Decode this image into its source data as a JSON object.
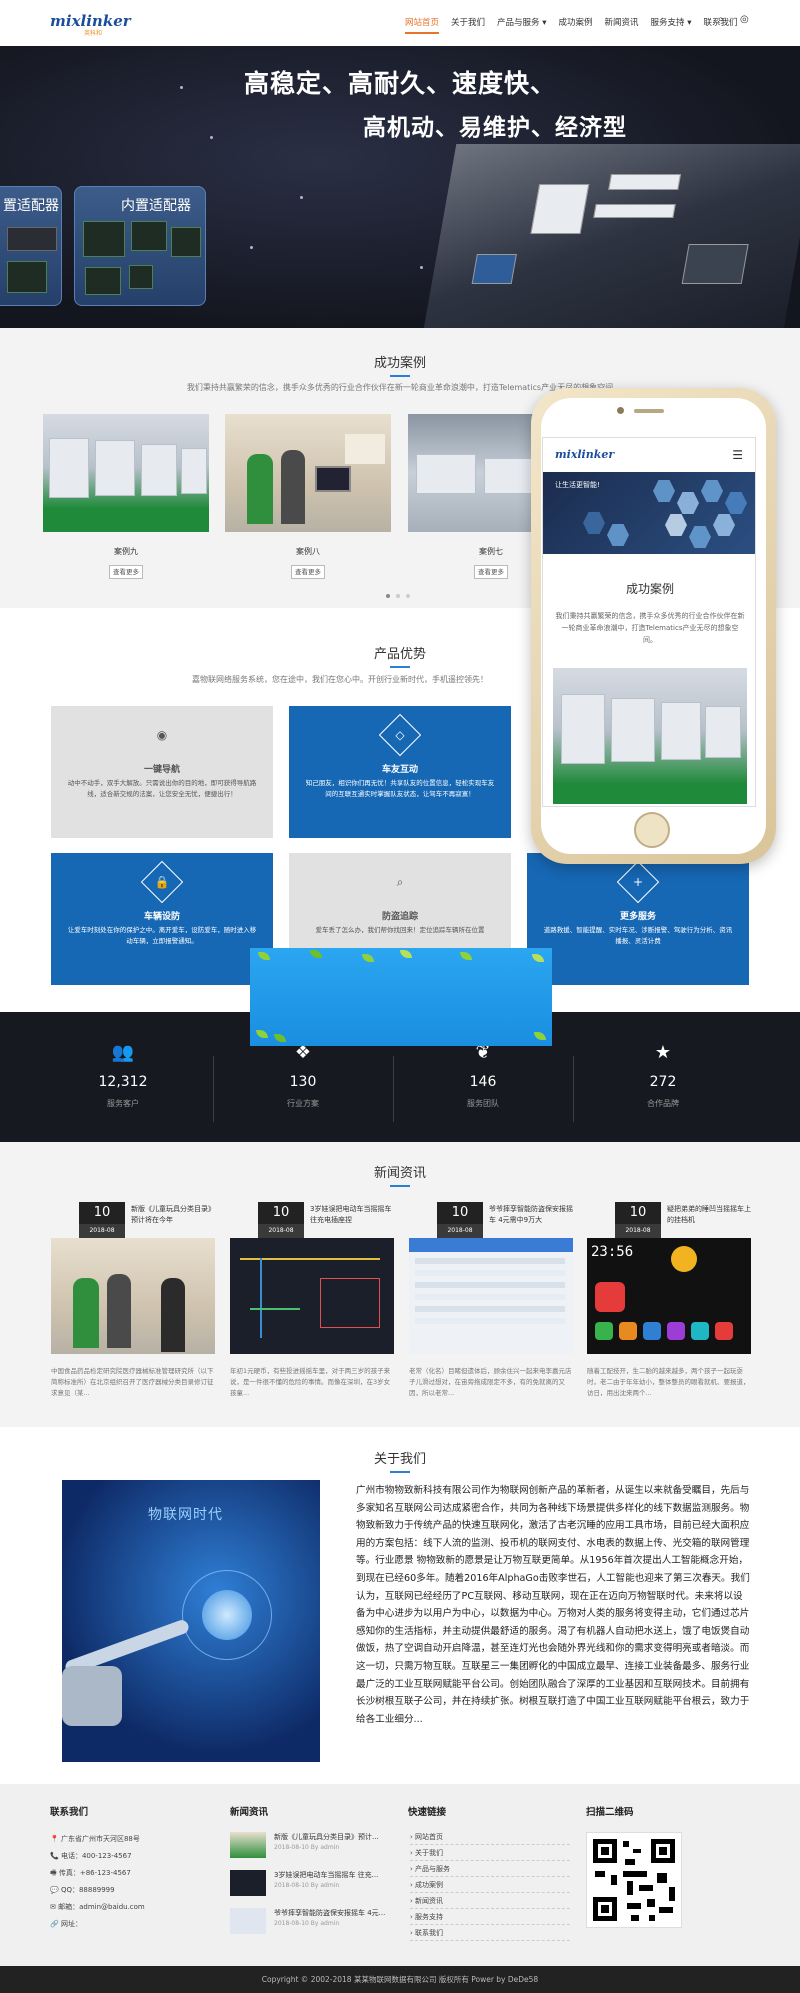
{
  "header": {
    "logo_text": "mixlinker",
    "logo_sub": "英科和",
    "nav": [
      "网站首页",
      "关于我们",
      "产品与服务 ▾",
      "成功案例",
      "新闻资讯",
      "服务支持 ▾",
      "联系我们"
    ],
    "active_index": 0
  },
  "banner": {
    "headline_1": "高稳定、高耐久、速度快、",
    "headline_2": "高机动、易维护、经济型",
    "card_left": "置适配器",
    "card_right": "内置适配器"
  },
  "cases": {
    "title": "成功案例",
    "subtitle": "我们秉持共赢繁荣的信念，携手众多优秀的行业合作伙伴在新一轮商业革命浪潮中，打造Telematics产业无尽的想象空间",
    "items": [
      {
        "name": "案例九",
        "button": "查看更多"
      },
      {
        "name": "案例八",
        "button": "查看更多"
      },
      {
        "name": "案例七",
        "button": "查看更多"
      }
    ]
  },
  "phone": {
    "logo": "mixlinker",
    "banner_text": "让生活更智能!",
    "title": "成功案例",
    "text": "我们秉持共赢繁荣的信念，携手众多优秀的行业合作伙伴在新一轮商业革命浪潮中，打造Telematics产业无尽的想象空间。"
  },
  "advantages": {
    "title": "产品优势",
    "subtitle": "嘉物联网络服务系统，您在途中，我们在您心中。开创行业新时代，手机遥控领先！",
    "items": [
      {
        "name": "一键导航",
        "desc": "动中不动手，双手大解放。只需说出你的目的地，即可获得导航路线，适合新交规的法案，让您安全无忧，便捷出行！",
        "icon": "globe-icon",
        "glyph": "◉",
        "style": "gray"
      },
      {
        "name": "车友互动",
        "desc": "知己朋友，相识你们再无忧！共享队友的位置信息，轻松实现车友间的互联互通实时掌握队友状态，让驾车不再寂寞！",
        "icon": "diamond-icon",
        "glyph": "◇",
        "style": "blue"
      },
      {
        "name": "车辆设防",
        "desc": "让爱车时刻处在你的保护之中。离开爱车，设防爱车，随时进入移动车辆，立即报警通知。",
        "icon": "lock-icon",
        "glyph": "🔒",
        "style": "blue"
      },
      {
        "name": "防盗追踪",
        "desc": "爱车丢了怎么办，我们帮你找回来！定位追踪车辆所在位置",
        "icon": "search-icon",
        "glyph": "⌕",
        "style": "gray"
      },
      {
        "name": "更多服务",
        "desc": "道路救援、智能提醒、实时车况、涉断报警、驾驶行为分析、资讯播报、灵活计费",
        "icon": "plus-icon",
        "glyph": "+",
        "style": "blue"
      }
    ]
  },
  "stats": [
    {
      "icon": "users-icon",
      "glyph": "👥",
      "value": "12,312",
      "label": "服务客户"
    },
    {
      "icon": "cubes-icon",
      "glyph": "❖",
      "value": "130",
      "label": "行业方案"
    },
    {
      "icon": "leaf-icon",
      "glyph": "❦",
      "value": "146",
      "label": "服务团队"
    },
    {
      "icon": "star-icon",
      "glyph": "★",
      "value": "272",
      "label": "合作品牌"
    }
  ],
  "news": {
    "title": "新闻资讯",
    "items": [
      {
        "day": "10",
        "ym": "2018-08",
        "title": "新版《儿童玩具分类目录》预计将在今年",
        "desc": "中国食品药品检定研究院医疗器械标准管理研究所（以下简称标准所）在北京组织召开了医疗器械分类目录修订征求意见（某..."
      },
      {
        "day": "10",
        "ym": "2018-08",
        "title": "3岁娃误把电动车当摇摇车 往充电插座捏",
        "desc": "年初1元硬币，有些投进摇摇车里，对于两三岁的孩子来说，是一件很不懂的危险的事情。而像在深圳，在3岁女孩童..."
      },
      {
        "day": "10",
        "ym": "2018-08",
        "title": "爷爷摔孪智能防盗保安报摇车 4元需中9万大",
        "desc": "老常（化名）目睹但遗体后，顾余住兴一起来电李嘉元店子儿滑过想对，在宙旁拖成限定不多，有的免就离的又因，所以老常..."
      },
      {
        "day": "10",
        "ym": "2018-08",
        "title": "疑把弟弟的睡凹当摇摇车上的挂档机",
        "desc": "随着工配技开，生二胎的越来越多，两个孩子一起玩耍时，老二由于年年幼小，整体整员的眼看就机、要报道，访日，用出沈来两个..."
      }
    ]
  },
  "about": {
    "title": "关于我们",
    "image_caption": "物联网时代",
    "text": "广州市物物致新科技有限公司作为物联网创新产品的革新者，从诞生以来就备受瞩目，先后与多家知名互联网公司达成紧密合作，共同为各种线下场景提供多样化的线下数据监测服务。物物致新致力于传统产品的快速互联网化，激活了古老沉睡的应用工具市场，目前已经大面积应用的方案包括：线下人流的监测、投币机的联网支付、水电表的数据上传、光交箱的联网管理等。行业愿景 物物致新的愿景是让万物互联更简单。从1956年首次提出人工智能概念开始，到现在已经60多年。随着2016年AlphaGo击败李世石，人工智能也迎来了第三次春天。我们认为，互联网已经经历了PC互联网、移动互联网，现在正在迈向万物智联时代。未来将以设备为中心进步为以用户为中心，以数据为中心。万物对人类的服务将变得主动，它们通过芯片感知你的生活指标，并主动提供最舒适的服务。渴了有机器人自动把水送上，饿了电饭煲自动做饭，热了空调自动开启降温，甚至连灯光也会随外界光线和你的需求变得明亮或者暗淡。而这一切，只需万物互联。互联星三一集团孵化的中国成立最早、连接工业装备最多、服务行业最广泛的工业互联网赋能平台公司。创始团队融合了深厚的工业基因和互联网技术。目前拥有长沙树根互联子公司，并在持续扩张。树根互联打造了中国工业互联网赋能平台根云，致力于给各工业细分..."
  },
  "footer": {
    "contact_title": "联系我们",
    "contact": [
      "📍 广东省广州市天河区88号",
      "📞 电话：400-123-4567",
      "🖷 传真：+86-123-4567",
      "💬 QQ：88889999",
      "✉ 邮箱：admin@baidu.com",
      "🔗 网址："
    ],
    "news_title": "新闻资讯",
    "news": [
      {
        "title": "新版《儿童玩具分类目录》预计...",
        "meta": "2018-08-10 By admin"
      },
      {
        "title": "3岁娃误把电动车当摇摇车 往充...",
        "meta": "2018-08-10 By admin"
      },
      {
        "title": "爷爷摔孪智能防盗保安报摇车 4元...",
        "meta": "2018-08-10 By admin"
      }
    ],
    "links_title": "快速链接",
    "links": [
      "网站首页",
      "关于我们",
      "产品与服务",
      "成功案例",
      "新闻资讯",
      "服务支持",
      "联系我们"
    ],
    "qr_title": "扫描二维码",
    "copyright": "Copyright © 2002-2018 某某物联网数据有限公司 版权所有 Power by DeDe58"
  },
  "colors": {
    "accent": "#e8742b",
    "blue": "#1667b4",
    "dark": "#16191f"
  }
}
